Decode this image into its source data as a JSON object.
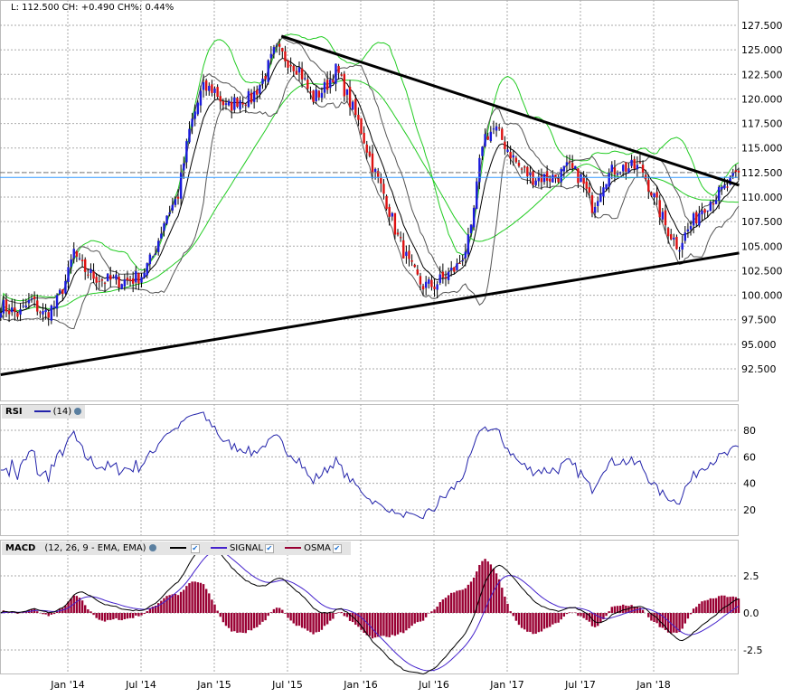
{
  "header": {
    "text": "L: 112.500 CH: +0.490 CH%: 0.44%"
  },
  "rsi_legend": {
    "label": "RSI",
    "params": "(14)"
  },
  "macd_legend": {
    "label": "MACD",
    "params": "(12, 26, 9 - EMA, EMA)",
    "signal": "SIGNAL",
    "osma": "OSMA",
    "check": "✔"
  },
  "colors": {
    "up": "#1a1adc",
    "down": "#dd1111",
    "bb": "#22cc22",
    "ma": "#000000",
    "rsi": "#2222aa",
    "macd": "#000000",
    "signal": "#4422cc",
    "osma": "#990033",
    "trend": "#000000",
    "last": "#3399ff"
  },
  "chart_data": [
    {
      "type": "candlestick",
      "title": "Price",
      "y_ticks": [
        "127.500",
        "125.000",
        "122.500",
        "120.000",
        "117.500",
        "115.000",
        "112.500",
        "110.000",
        "107.500",
        "105.000",
        "102.500",
        "100.000",
        "97.500",
        "95.000",
        "92.500"
      ],
      "ylim": [
        90.5,
        129
      ],
      "x_ticks": [
        "Jan '14",
        "Jul '14",
        "Jan '15",
        "Jul '15",
        "Jan '16",
        "Jul '16",
        "Jan '17",
        "Jul '17",
        "Jan '18"
      ],
      "monthly_close_months_from_jan14": [
        -5.5,
        -4,
        -3,
        -2,
        -1,
        0,
        0.5,
        1,
        2,
        3,
        4,
        5,
        6,
        7,
        8,
        9,
        10,
        11,
        12,
        13,
        14,
        15,
        16,
        17,
        18,
        19,
        20,
        21,
        22,
        23,
        24,
        25,
        26,
        27,
        28,
        29,
        30,
        31,
        32,
        33,
        34,
        35,
        36,
        37,
        38,
        39,
        40,
        41,
        42,
        43,
        44,
        45,
        46,
        47,
        48,
        49,
        50,
        51,
        52,
        53,
        54,
        55
      ],
      "monthly_close": [
        99,
        98,
        99.5,
        98,
        99,
        102,
        104.5,
        103,
        102,
        101.5,
        101.5,
        101.5,
        102,
        104,
        108,
        110,
        117,
        121,
        121,
        119,
        120,
        120,
        122,
        125,
        124,
        123,
        120,
        121,
        123,
        120,
        117,
        113,
        110,
        106,
        103,
        101,
        101,
        102,
        103,
        106,
        116,
        117,
        115,
        113,
        112,
        112,
        112,
        113,
        112,
        109,
        112,
        113,
        113,
        113,
        110,
        107,
        105,
        107,
        109,
        110,
        111,
        112.5
      ],
      "last": 112.5,
      "trendlines": [
        {
          "name": "upper",
          "from": [
            17.5,
            126.4
          ],
          "to": [
            55,
            111.2
          ]
        },
        {
          "name": "lower",
          "from": [
            -5.5,
            91.9
          ],
          "to": [
            55,
            104.3
          ]
        }
      ]
    },
    {
      "type": "line",
      "title": "RSI (14)",
      "y_ticks": [
        "80",
        "60",
        "40",
        "20"
      ],
      "ylim": [
        0,
        100
      ]
    },
    {
      "type": "line+bar",
      "title": "MACD (12, 26, 9 - EMA, EMA)",
      "y_ticks": [
        "2.5",
        "0.0",
        "-2.5"
      ],
      "ylim": [
        -4.2,
        4.2
      ]
    }
  ]
}
